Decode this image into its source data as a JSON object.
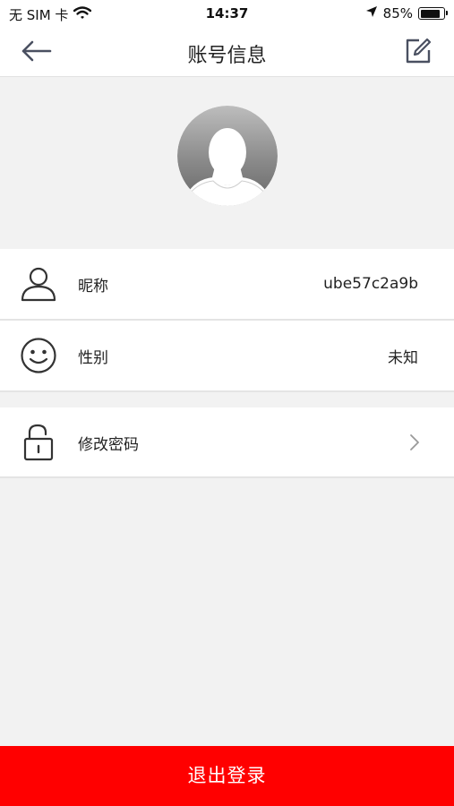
{
  "status_bar": {
    "carrier": "无 SIM 卡",
    "time": "14:37",
    "battery_text": "85%",
    "battery_level": 0.85
  },
  "nav": {
    "title": "账号信息",
    "back_icon": "back-arrow-icon",
    "edit_icon": "edit-icon"
  },
  "profile": {
    "avatar_icon": "default-avatar-icon"
  },
  "rows": [
    {
      "label": "昵称",
      "value": "ube57c2a9b",
      "icon": "user-icon"
    },
    {
      "label": "性别",
      "value": "未知",
      "icon": "smile-face-icon"
    },
    {
      "label": "修改密码",
      "icon": "lock-icon",
      "chevron": "chevron-right-icon"
    }
  ],
  "logout": {
    "label": "退出登录"
  },
  "colors": {
    "accent_red": "#ff0000",
    "background": "#f2f2f2",
    "nav_icon": "#4a5061"
  }
}
